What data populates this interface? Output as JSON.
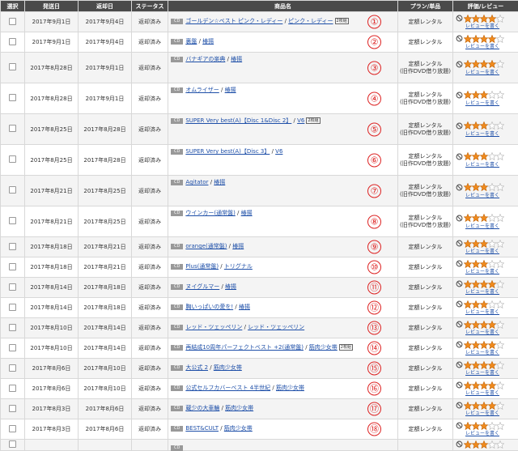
{
  "columns": [
    "選択",
    "発送日",
    "返却日",
    "ステータス",
    "商品名",
    "プラン/単品",
    "評価/レビュー"
  ],
  "colors": {
    "header_bg": "#4a4a4a",
    "link": "#1e4fa8",
    "circle_number": "#dd2222",
    "star": "#f08a1c"
  },
  "icons": {
    "media": "cd-tag",
    "star": "star-icon",
    "no_rating": "no-sign-icon"
  },
  "rows": [
    {
      "ship": "2017年9月1日",
      "ret": "2017年9月4日",
      "status": "返却済み",
      "media": "CD",
      "title": "ゴールデン☆ベスト ピンク・レディー",
      "artist": "ピンク・レディー",
      "badge": "2枚組",
      "num": "①",
      "plan1": "定額レンタル",
      "plan2": "",
      "rating": 4,
      "review": "レビューを書く"
    },
    {
      "ship": "2017年9月1日",
      "ret": "2017年9月4日",
      "status": "返却済み",
      "media": "CD",
      "title": "裏盤",
      "artist": "椿揚",
      "badge": "",
      "num": "②",
      "plan1": "定額レンタル",
      "plan2": "",
      "rating": 4,
      "review": "レビューを書く"
    },
    {
      "ship": "2017年8月28日",
      "ret": "2017年9月1日",
      "status": "返却済み",
      "media": "CD",
      "title": "バナギアの楽典",
      "artist": "椿揚",
      "badge": "",
      "num": "③",
      "plan1": "定額レンタル",
      "plan2": "(旧作DVD借り放題)",
      "rating": 4,
      "review": "レビューを書く"
    },
    {
      "ship": "2017年8月28日",
      "ret": "2017年9月1日",
      "status": "返却済み",
      "media": "CD",
      "title": "オムライザー",
      "artist": "椿揚",
      "badge": "",
      "num": "④",
      "plan1": "定額レンタル",
      "plan2": "(旧作DVD借り放題)",
      "rating": 3,
      "review": "レビューを書く"
    },
    {
      "ship": "2017年8月25日",
      "ret": "2017年8月28日",
      "status": "返却済み",
      "media": "CD",
      "title": "SUPER Very best(A)【Disc 1&Disc 2】",
      "artist": "V6",
      "badge": "2枚組",
      "num": "⑤",
      "plan1": "定額レンタル",
      "plan2": "(旧作DVD借り放題)",
      "rating": 3,
      "review": "レビューを書く"
    },
    {
      "ship": "2017年8月25日",
      "ret": "2017年8月28日",
      "status": "返却済み",
      "media": "CD",
      "title": "SUPER Very best(A)【Disc 3】",
      "artist": "V6",
      "badge": "",
      "num": "⑥",
      "plan1": "定額レンタル",
      "plan2": "(旧作DVD借り放題)",
      "rating": 3,
      "review": "レビューを書く"
    },
    {
      "ship": "2017年8月21日",
      "ret": "2017年8月25日",
      "status": "返却済み",
      "media": "CD",
      "title": "Agitator",
      "artist": "椿揚",
      "badge": "",
      "num": "⑦",
      "plan1": "定額レンタル",
      "plan2": "(旧作DVD借り放題)",
      "rating": 3,
      "review": "レビューを書く"
    },
    {
      "ship": "2017年8月21日",
      "ret": "2017年8月25日",
      "status": "返却済み",
      "media": "CD",
      "title": "ウインカー(通常盤)",
      "artist": "椿揚",
      "badge": "",
      "num": "⑧",
      "plan1": "定額レンタル",
      "plan2": "(旧作DVD借り放題)",
      "rating": 3,
      "review": "レビューを書く"
    },
    {
      "ship": "2017年8月18日",
      "ret": "2017年8月21日",
      "status": "返却済み",
      "media": "CD",
      "title": "orange(通常盤)",
      "artist": "椿揚",
      "badge": "",
      "num": "⑨",
      "plan1": "定額レンタル",
      "plan2": "",
      "rating": 3,
      "review": "レビューを書く"
    },
    {
      "ship": "2017年8月18日",
      "ret": "2017年8月21日",
      "status": "返却済み",
      "media": "CD",
      "title": "Plus(通常盤)",
      "artist": "トリグナル",
      "badge": "",
      "num": "⑩",
      "plan1": "定額レンタル",
      "plan2": "",
      "rating": 3,
      "review": "レビューを書く"
    },
    {
      "ship": "2017年8月14日",
      "ret": "2017年8月18日",
      "status": "返却済み",
      "media": "CD",
      "title": "ヌイグルマー",
      "artist": "椿揚",
      "badge": "",
      "num": "⑪",
      "plan1": "定額レンタル",
      "plan2": "",
      "rating": 4,
      "review": "レビューを書く"
    },
    {
      "ship": "2017年8月14日",
      "ret": "2017年8月18日",
      "status": "返却済み",
      "media": "CD",
      "title": "胸いっぱいの愛を!",
      "artist": "椿揚",
      "badge": "",
      "num": "⑫",
      "plan1": "定額レンタル",
      "plan2": "",
      "rating": 3,
      "review": "レビューを書く"
    },
    {
      "ship": "2017年8月10日",
      "ret": "2017年8月14日",
      "status": "返却済み",
      "media": "CD",
      "title": "レッド・ツェッペリン",
      "artist": "レッド・ツェッペリン",
      "badge": "",
      "num": "⑬",
      "plan1": "定額レンタル",
      "plan2": "",
      "rating": 4,
      "review": "レビューを書く"
    },
    {
      "ship": "2017年8月10日",
      "ret": "2017年8月14日",
      "status": "返却済み",
      "media": "CD",
      "title": "再結成10周年パーフェクトベスト +2(通常盤)",
      "artist": "筋肉少女帯",
      "badge": "2枚組",
      "num": "⑭",
      "plan1": "定額レンタル",
      "plan2": "",
      "rating": 4,
      "review": "レビューを書く"
    },
    {
      "ship": "2017年8月6日",
      "ret": "2017年8月10日",
      "status": "返却済み",
      "media": "CD",
      "title": "大公式 2",
      "artist": "筋肉少女帯",
      "badge": "",
      "num": "⑮",
      "plan1": "定額レンタル",
      "plan2": "",
      "rating": 4,
      "review": "レビューを書く"
    },
    {
      "ship": "2017年8月6日",
      "ret": "2017年8月10日",
      "status": "返却済み",
      "media": "CD",
      "title": "公式セルフカバーベスト 4半世紀",
      "artist": "筋肉少女帯",
      "badge": "",
      "num": "⑯",
      "plan1": "定額レンタル",
      "plan2": "",
      "rating": 4,
      "review": "レビューを書く"
    },
    {
      "ship": "2017年8月3日",
      "ret": "2017年8月6日",
      "status": "返却済み",
      "media": "CD",
      "title": "蔵少の大車輪",
      "artist": "筋肉少女帯",
      "badge": "",
      "num": "⑰",
      "plan1": "定額レンタル",
      "plan2": "",
      "rating": 4,
      "review": "レビューを書く"
    },
    {
      "ship": "2017年8月3日",
      "ret": "2017年8月6日",
      "status": "返却済み",
      "media": "CD",
      "title": "BEST&CULT",
      "artist": "筋肉少女帯",
      "badge": "",
      "num": "⑱",
      "plan1": "定額レンタル",
      "plan2": "",
      "rating": 3,
      "review": "レビューを書く"
    },
    {
      "ship": "",
      "ret": "",
      "status": "",
      "media": "CD",
      "title": "",
      "artist": "",
      "badge": "",
      "num": "",
      "plan1": "",
      "plan2": "",
      "rating": 3,
      "review": ""
    }
  ]
}
